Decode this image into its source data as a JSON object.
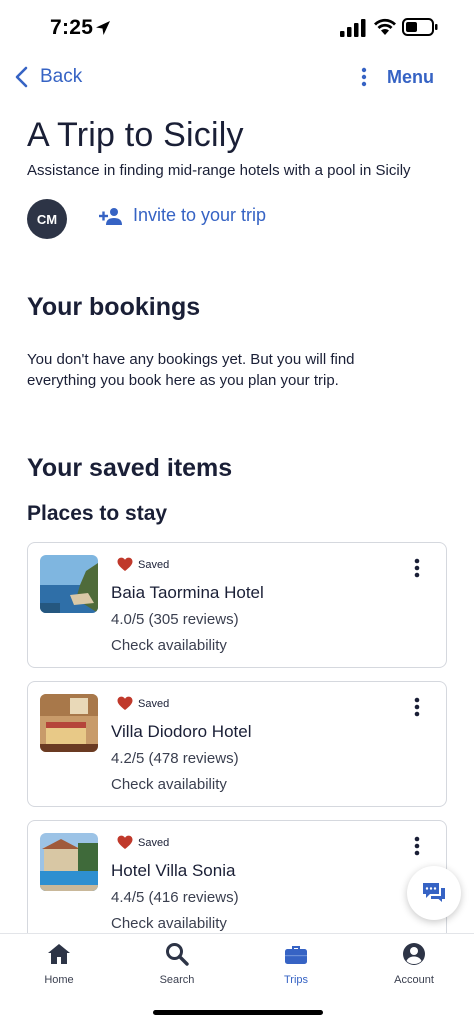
{
  "status_bar": {
    "time": "7:25"
  },
  "nav": {
    "back_label": "Back",
    "menu_label": "Menu"
  },
  "trip": {
    "title": "A Trip to Sicily",
    "subtitle": "Assistance in finding mid-range hotels with a pool in Sicily",
    "avatar_initials": "CM",
    "invite_label": "Invite to your trip"
  },
  "bookings": {
    "heading": "Your bookings",
    "empty_text": "You don't have any bookings yet. But you will find everything you book here as you plan your trip."
  },
  "saved": {
    "heading": "Your saved items",
    "places_heading": "Places to stay",
    "items": [
      {
        "saved_label": "Saved",
        "name": "Baia Taormina Hotel",
        "rating": "4.0/5 (305 reviews)",
        "availability": "Check availability"
      },
      {
        "saved_label": "Saved",
        "name": "Villa Diodoro Hotel",
        "rating": "4.2/5 (478 reviews)",
        "availability": "Check availability"
      },
      {
        "saved_label": "Saved",
        "name": "Hotel Villa Sonia",
        "rating": "4.4/5 (416 reviews)",
        "availability": "Check availability"
      }
    ]
  },
  "tabbar": {
    "tabs": [
      {
        "label": "Home",
        "icon": "home-icon"
      },
      {
        "label": "Search",
        "icon": "search-icon"
      },
      {
        "label": "Trips",
        "icon": "briefcase-icon",
        "active": true
      },
      {
        "label": "Account",
        "icon": "account-icon"
      }
    ]
  },
  "colors": {
    "accent": "#3663c4",
    "heart": "#c0392b",
    "text": "#1a1f36",
    "avatar_bg": "#2d3446"
  }
}
